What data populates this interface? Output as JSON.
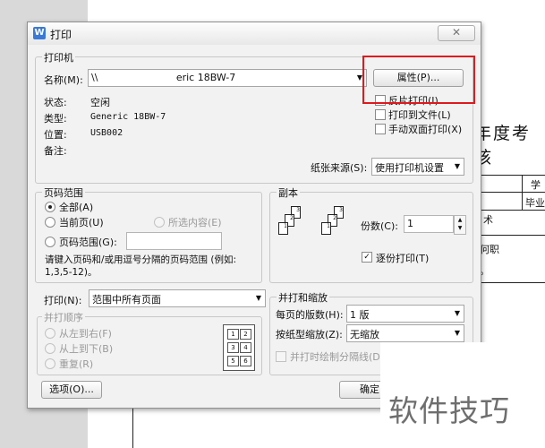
{
  "document": {
    "title": "年度考核",
    "cells": [
      "学",
      "毕业",
      "术",
      "何职",
      "。"
    ]
  },
  "dialog": {
    "title": "打印",
    "app_icon": "wps-icon",
    "close_label": "✕"
  },
  "printer": {
    "group_label": "打印机",
    "name_label": "名称(M):",
    "name_value": "\\\\                         eric 18BW-7",
    "properties_label": "属性(P)...",
    "status_label": "状态:",
    "status_value": "空闲",
    "type_label": "类型:",
    "type_value": "Generic 18BW-7",
    "location_label": "位置:",
    "location_value": "USB002",
    "comment_label": "备注:",
    "comment_value": "",
    "reverse_print_label": "反片打印(I)",
    "print_to_file_label": "打印到文件(L)",
    "manual_duplex_label": "手动双面打印(X)",
    "paper_source_label": "纸张来源(S):",
    "paper_source_value": "使用打印机设置"
  },
  "page_range": {
    "group_label": "页码范围",
    "all_label": "全部(A)",
    "current_label": "当前页(U)",
    "selection_label": "所选内容(E)",
    "range_label": "页码范围(G):",
    "range_value": "",
    "hint": "请键入页码和/或用逗号分隔的页码范围 (例如: 1,3,5-12)。",
    "selected": "all"
  },
  "copies": {
    "group_label": "副本",
    "count_label": "份数(C):",
    "count_value": "1",
    "collate_label": "逐份打印(T)",
    "collate_checked": true
  },
  "print_what": {
    "label": "打印(N):",
    "value": "范围中所有页面"
  },
  "order": {
    "group_label": "并打顺序",
    "ltr_label": "从左到右(F)",
    "ttb_label": "从上到下(B)",
    "repeat_label": "重复(R)",
    "grid": [
      "1",
      "2",
      "3",
      "4",
      "5",
      "6"
    ]
  },
  "zoom": {
    "group_label": "并打和缩放",
    "pages_per_sheet_label": "每页的版数(H):",
    "pages_per_sheet_value": "1 版",
    "scale_label": "按纸型缩放(Z):",
    "scale_value": "无缩放",
    "draw_border_label": "并打时绘制分隔线(D)"
  },
  "footer": {
    "options_label": "选项(O)...",
    "ok_label": "确定"
  },
  "watermark": "软件技巧",
  "colors": {
    "highlight": "#e0191f",
    "app_icon": "#3b79d6"
  }
}
